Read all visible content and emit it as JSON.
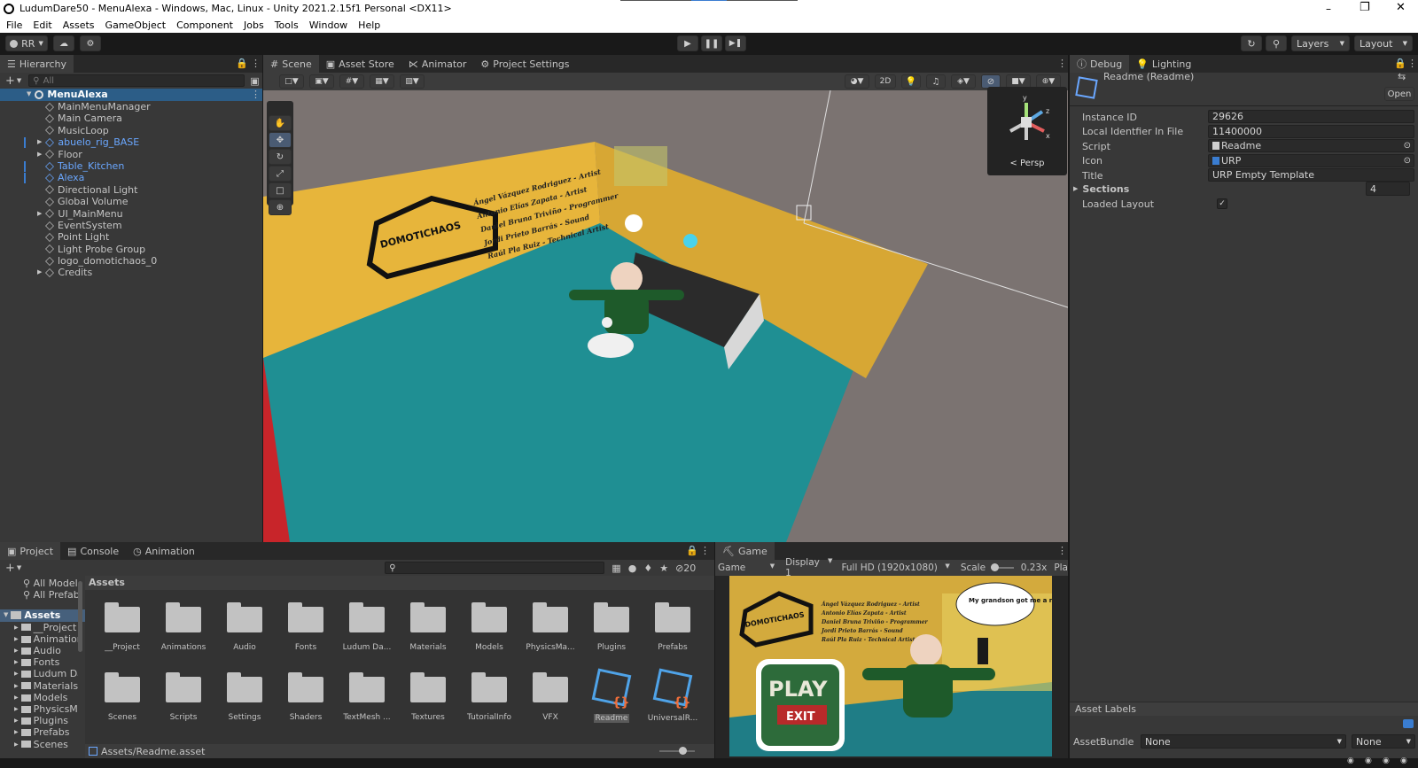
{
  "window": {
    "title": "LudumDare50 - MenuAlexa - Windows, Mac, Linux - Unity 2021.2.15f1 Personal <DX11>"
  },
  "menu": [
    "File",
    "Edit",
    "Assets",
    "GameObject",
    "Component",
    "Jobs",
    "Tools",
    "Window",
    "Help"
  ],
  "toolbar": {
    "account": "RR",
    "layers": "Layers",
    "layout": "Layout"
  },
  "hierarchy": {
    "tab": "Hierarchy",
    "search_placeholder": "All",
    "scene": "MenuAlexa",
    "items": [
      {
        "label": "MainMenuManager",
        "blue": false,
        "arrow": false
      },
      {
        "label": "Main Camera",
        "blue": false,
        "arrow": false
      },
      {
        "label": "MusicLoop",
        "blue": false,
        "arrow": false
      },
      {
        "label": "abuelo_rig_BASE",
        "blue": true,
        "arrow": true
      },
      {
        "label": "Floor",
        "blue": false,
        "arrow": true
      },
      {
        "label": "Table_Kitchen",
        "blue": true,
        "arrow": false
      },
      {
        "label": "Alexa",
        "blue": true,
        "arrow": false
      },
      {
        "label": "Directional Light",
        "blue": false,
        "arrow": false
      },
      {
        "label": "Global Volume",
        "blue": false,
        "arrow": false
      },
      {
        "label": "UI_MainMenu",
        "blue": false,
        "arrow": true
      },
      {
        "label": "EventSystem",
        "blue": false,
        "arrow": false
      },
      {
        "label": "Point Light",
        "blue": false,
        "arrow": false
      },
      {
        "label": "Light Probe Group",
        "blue": false,
        "arrow": false
      },
      {
        "label": "logo_domotichaos_0",
        "blue": false,
        "arrow": false
      },
      {
        "label": "Credits",
        "blue": false,
        "arrow": true
      }
    ]
  },
  "sceneTabs": [
    "Scene",
    "Asset Store",
    "Animator",
    "Project Settings"
  ],
  "scene": {
    "mode_2d": "2D",
    "gizmo_label": "Persp",
    "x": "x",
    "y": "y",
    "z": "z",
    "wall_title": "DOMOTICHAOS",
    "credits": [
      "Ángel Vázquez Rodriguez - Artist",
      "Antonio Elías Zapata - Artist",
      "Daniel Bruna Triviño - Programmer",
      "Jordi Prieto Barrás - Sound",
      "Raúl Pla Ruiz - Technical Artist"
    ]
  },
  "inspector": {
    "tabs": [
      "Debug",
      "Lighting"
    ],
    "asset_title": "Readme (Readme)",
    "open_button": "Open",
    "fields": [
      {
        "name": "Instance ID",
        "value": "29626"
      },
      {
        "name": "Local Identfier In File",
        "value": "11400000"
      },
      {
        "name": "Script",
        "value": "Readme"
      },
      {
        "name": "Icon",
        "value": "URP"
      },
      {
        "name": "Title",
        "value": "URP Empty Template"
      }
    ],
    "sections_label": "Sections",
    "sections_value": "4",
    "loaded_layout": "Loaded Layout",
    "check": "✓",
    "asset_labels": "Asset Labels",
    "assetbundle_label": "AssetBundle",
    "assetbundle_value": "None",
    "variant_value": "None"
  },
  "project": {
    "tabs": [
      "Project",
      "Console",
      "Animation"
    ],
    "hidden_count": "20",
    "breadcrumb": "Assets",
    "favorites": [
      "All Model",
      "All Prefab"
    ],
    "tree_root": "Assets",
    "tree": [
      "__Project",
      "Animation",
      "Audio",
      "Fonts",
      "Ludum Da",
      "Materials",
      "Models",
      "PhysicsM",
      "Plugins",
      "Prefabs",
      "Scenes"
    ],
    "assets_row1": [
      "__Project",
      "Animations",
      "Audio",
      "Fonts",
      "Ludum Da...",
      "Materials",
      "Models",
      "PhysicsMa...",
      "Plugins",
      "Prefabs"
    ],
    "assets_row2": [
      "Scenes",
      "Scripts",
      "Settings",
      "Shaders",
      "TextMesh ...",
      "Textures",
      "TutorialInfo",
      "VFX",
      "Readme",
      "UniversalR..."
    ],
    "selected_path": "Assets/Readme.asset"
  },
  "game": {
    "tab": "Game",
    "mode": "Game",
    "display": "Display 1",
    "resolution": "Full HD (1920x1080)",
    "scale_label": "Scale",
    "scale_value": "0.23x",
    "play_short": "Pla",
    "speech": "My grandson got me a new Alexia!",
    "play_button": "PLAY",
    "exit_button": "EXIT",
    "logo": "DOMOTICHAOS",
    "credits": [
      "Ángel Vázquez Rodriguez - Artist",
      "Antonio Elías Zapata - Artist",
      "Daniel Bruna Triviño - Programmer",
      "Jordi Prieto Barrás - Sound",
      "Raúl Pla Ruiz - Technical Artist"
    ]
  }
}
